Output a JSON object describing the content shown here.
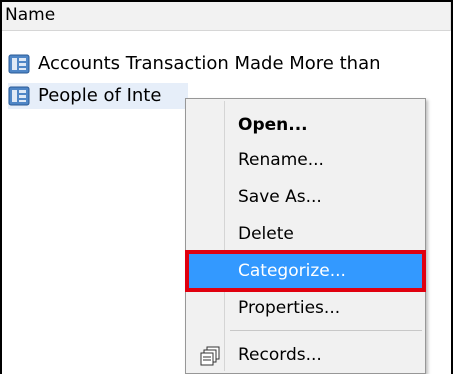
{
  "list": {
    "column_header": "Name",
    "rows": [
      {
        "label": "Accounts Transaction Made More than",
        "icon": "report-icon"
      },
      {
        "label": "People of Inte",
        "icon": "report-icon",
        "selected": true
      }
    ]
  },
  "context_menu": {
    "items": [
      {
        "label": "Open...",
        "bold": true
      },
      {
        "label": "Rename..."
      },
      {
        "label": "Save As..."
      },
      {
        "label": "Delete"
      },
      {
        "label": "Categorize...",
        "highlighted": true
      },
      {
        "label": "Properties..."
      },
      {
        "label": "Records...",
        "icon": "records-icon"
      }
    ]
  },
  "colors": {
    "highlight": "#3399ff",
    "annotation_box": "#e0000f",
    "menu_background": "#f1f1f1"
  }
}
